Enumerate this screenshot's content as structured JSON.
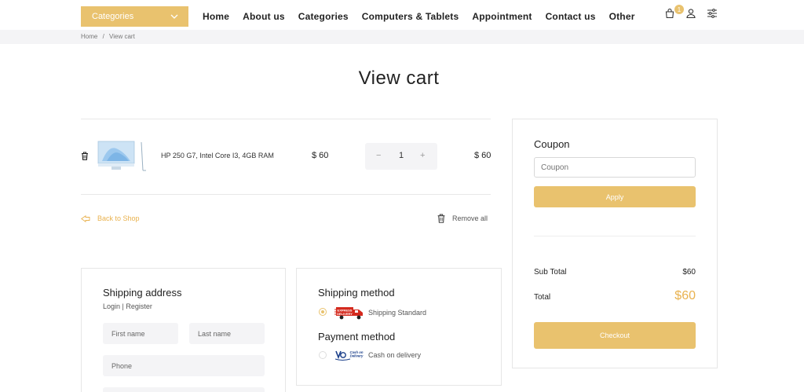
{
  "header": {
    "categories_button": "Categories",
    "nav": [
      "Home",
      "About us",
      "Categories",
      "Computers & Tablets",
      "Appointment",
      "Contact us",
      "Other"
    ],
    "cart_count": "1"
  },
  "breadcrumb": {
    "home": "Home",
    "separator": "/",
    "current": "View cart"
  },
  "page_title": "View cart",
  "cart": {
    "items": [
      {
        "name": "HP 250 G7, Intel Core I3, 4GB RAM",
        "price": "$ 60",
        "quantity": "1",
        "subtotal": "$ 60"
      }
    ],
    "qty_minus": "−",
    "qty_plus": "+",
    "back_to_shop": "Back to Shop",
    "remove_all": "Remove all"
  },
  "summary": {
    "coupon_title": "Coupon",
    "coupon_placeholder": "Coupon",
    "apply_label": "Apply",
    "subtotal_label": "Sub Total",
    "subtotal_value": "$60",
    "total_label": "Total",
    "total_value": "$60",
    "checkout_label": "Checkout"
  },
  "shipping_address": {
    "title": "Shipping address",
    "login_register": "Login | Register",
    "first_name": "First name",
    "last_name": "Last name",
    "phone": "Phone"
  },
  "shipping_method": {
    "title": "Shipping method",
    "option": "Shipping Standard",
    "logo_text": "EXPRESS DELIVERY"
  },
  "payment_method": {
    "title": "Payment method",
    "option": "Cash on delivery",
    "logo_text": "Cash on Delivery"
  },
  "colors": {
    "accent": "#e9c26e",
    "accent_text": "#e9b24f"
  }
}
